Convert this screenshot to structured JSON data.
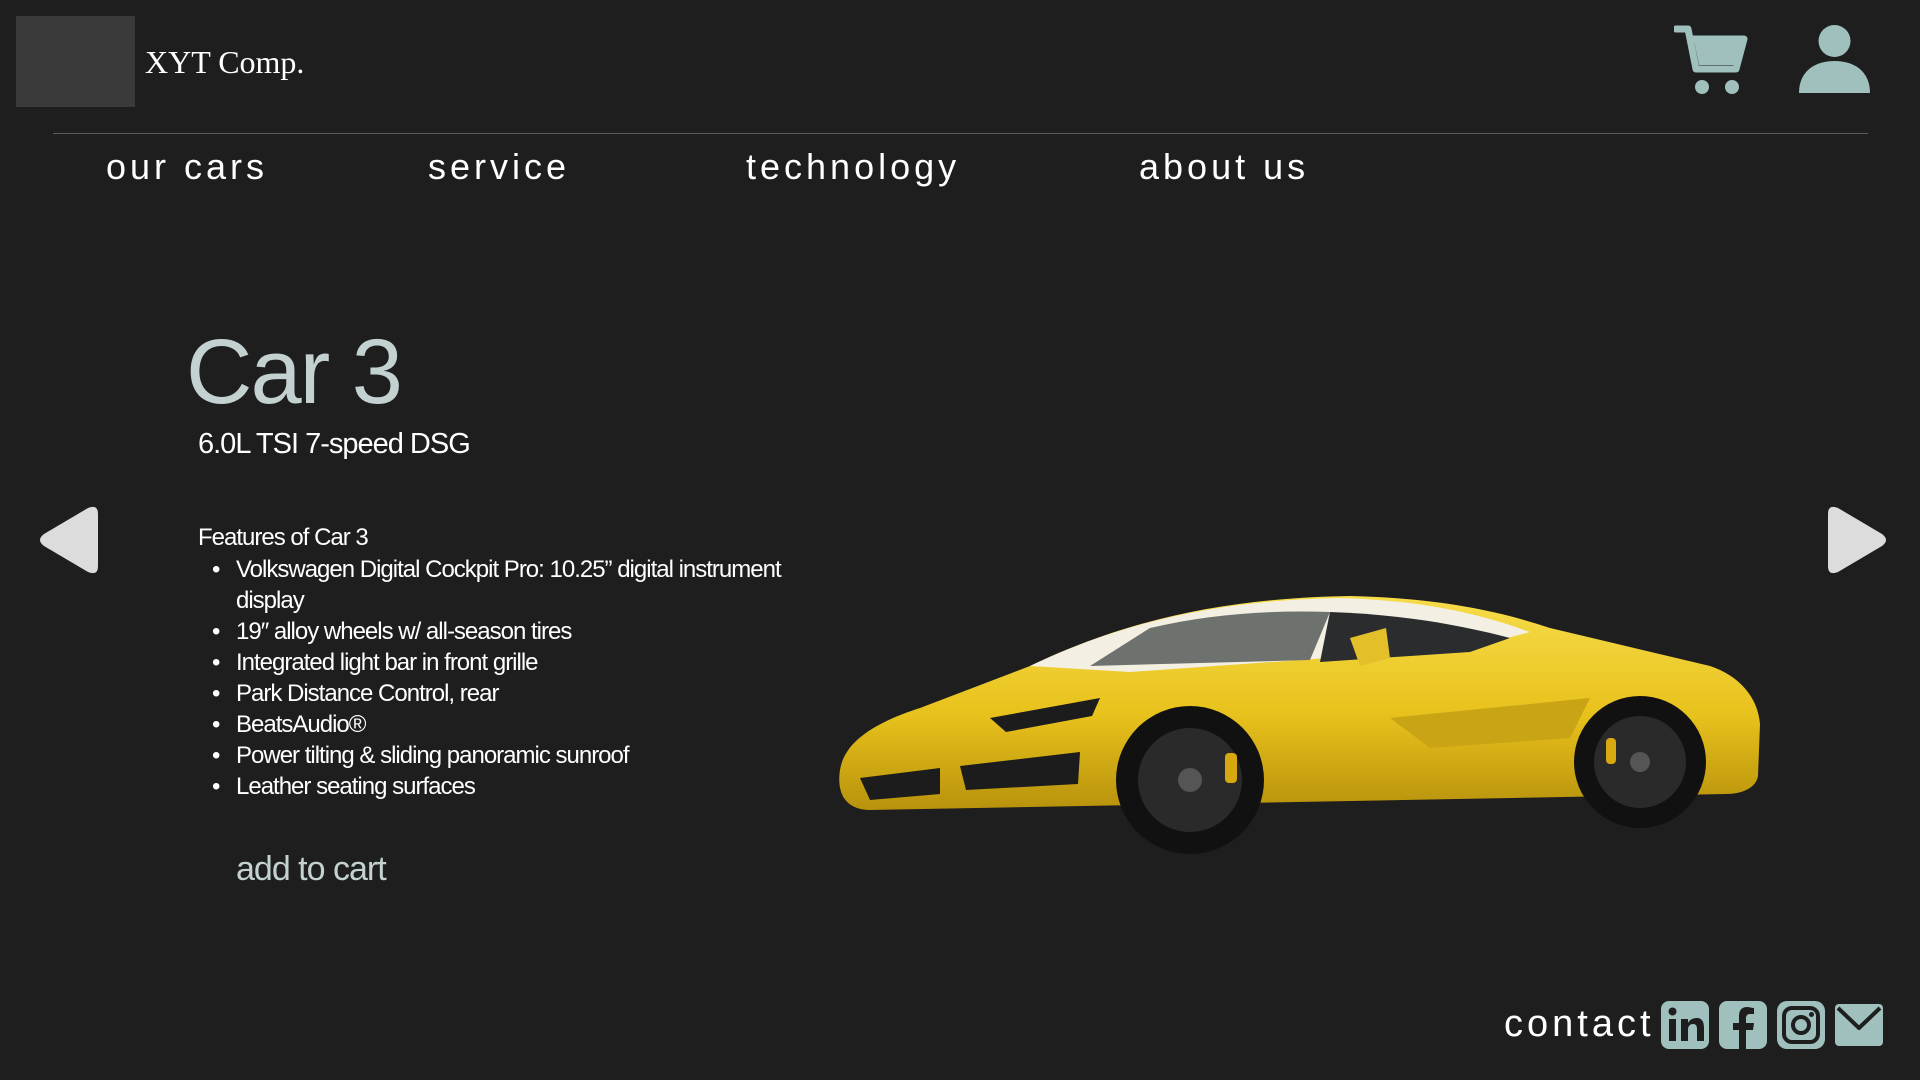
{
  "header": {
    "brand": "XYT Comp.",
    "icons": {
      "cart": "shopping-cart-icon",
      "user": "user-account-icon"
    }
  },
  "nav": {
    "items": [
      {
        "label": "our cars"
      },
      {
        "label": "service"
      },
      {
        "label": "technology"
      },
      {
        "label": "about us"
      }
    ]
  },
  "product": {
    "title": "Car 3",
    "engine": "6.0L TSI 7-speed DSG",
    "features_heading": "Features of Car 3",
    "features": [
      "Volkswagen Digital Cockpit Pro: 10.25” digital instrument display",
      "19″ alloy wheels w/ all-season tires",
      "Integrated light bar in front grille",
      "Park Distance Control, rear",
      "BeatsAudio®",
      "Power tilting & sliding panoramic sunroof",
      "Leather seating surfaces"
    ],
    "add_to_cart_label": "add to cart",
    "image": "yellow-sports-car",
    "car_color": "#e8c21c"
  },
  "carousel": {
    "prev_icon": "triangle-left-icon",
    "next_icon": "triangle-right-icon"
  },
  "footer": {
    "contact_label": "contact",
    "social_icons": [
      "linkedin-icon",
      "facebook-icon",
      "instagram-icon",
      "mail-icon"
    ]
  },
  "colors": {
    "background": "#1e1e1f",
    "icon_accent": "#9fc0bd",
    "title_accent": "#c3d1d1",
    "logo_placeholder": "#3a3a3b"
  }
}
